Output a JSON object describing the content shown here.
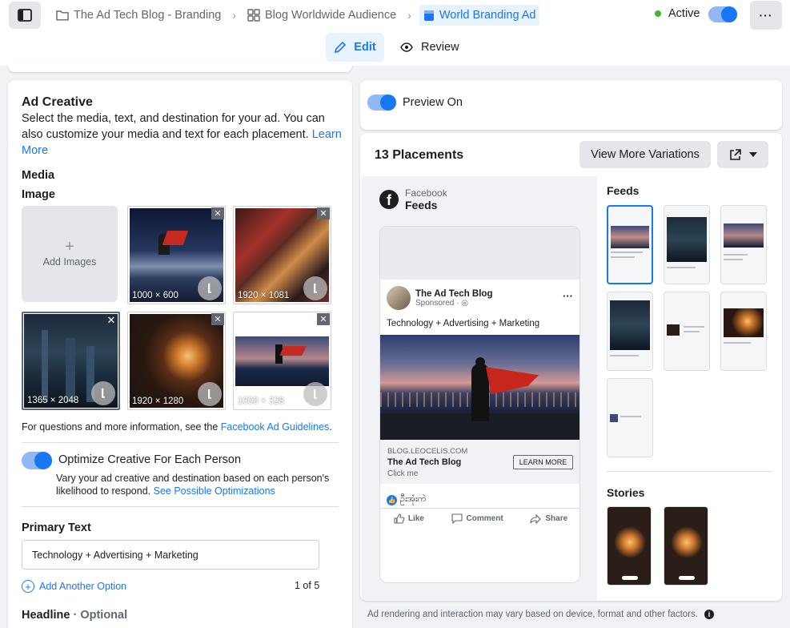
{
  "breadcrumb": {
    "campaign": "The Ad Tech Blog - Branding",
    "adset": "Blog Worldwide Audience",
    "ad": "World Branding Ad"
  },
  "status": {
    "label": "Active"
  },
  "tabs": {
    "edit": "Edit",
    "review": "Review"
  },
  "creative": {
    "title": "Ad Creative",
    "description": "Select the media, text, and destination for your ad. You can also customize your media and text for each placement.",
    "learn_more": "Learn More",
    "media_label": "Media",
    "image_label": "Image",
    "add_images": "Add Images",
    "images": [
      {
        "dimensions": "1000 × 600"
      },
      {
        "dimensions": "1920 × 1081"
      },
      {
        "dimensions": "1365 × 2048"
      },
      {
        "dimensions": "1920 × 1280"
      },
      {
        "dimensions": "1000 × 328"
      }
    ],
    "guidelines_prefix": "For questions and more information, see the",
    "guidelines_link": "Facebook Ad Guidelines",
    "optimize_title": "Optimize Creative For Each Person",
    "optimize_desc": "Vary your ad creative and destination based on each person's likelihood to respond.",
    "optimize_link": "See Possible Optimizations",
    "primary_text_label": "Primary Text",
    "primary_text_value": "Technology + Advertising + Marketing",
    "add_another": "Add Another Option",
    "option_counter": "1 of 5",
    "headline_label": "Headline",
    "headline_optional": "· Optional"
  },
  "preview": {
    "toggle_label": "Preview On",
    "placements_title": "13 Placements",
    "view_more": "View More Variations",
    "platform": "Facebook",
    "placement": "Feeds",
    "post": {
      "page_name": "The Ad Tech Blog",
      "sponsored": "Sponsored · ",
      "text": "Technology + Advertising + Marketing",
      "domain": "BLOG.LEOCELIS.COM",
      "headline": "The Ad Tech Blog",
      "subline": "Click me",
      "cta": "LEARN MORE",
      "reaction_text": "ဦးအုံးကဲ",
      "like": "Like",
      "comment": "Comment",
      "share": "Share"
    },
    "feeds_label": "Feeds",
    "stories_label": "Stories",
    "footer": "Ad rendering and interaction may vary based on device, format and other factors."
  },
  "colors": {
    "accent": "#1877f2",
    "active_dot": "#42b72a"
  }
}
